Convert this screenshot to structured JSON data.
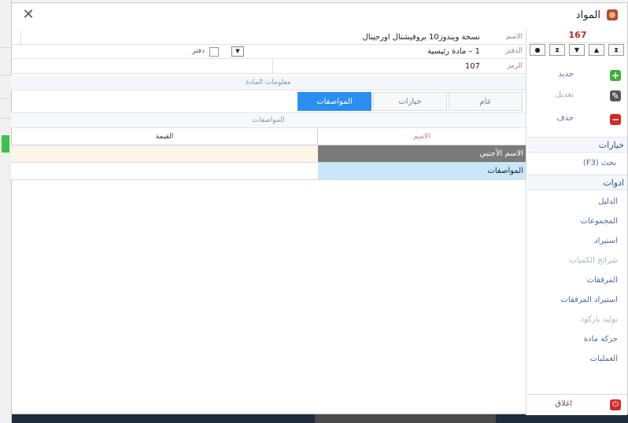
{
  "window": {
    "title": "المواد"
  },
  "sidebar": {
    "record_number": "167",
    "nav_buttons": [
      "●",
      "⧗",
      "▼",
      "▲",
      "⧗"
    ],
    "actions": [
      {
        "label": "جديد",
        "icon": "plus-icon",
        "color": "#3fae3f"
      },
      {
        "label": "تعديل",
        "icon": "edit-icon",
        "color": "#555555"
      },
      {
        "label": "حذف",
        "icon": "minus-icon",
        "color": "#d12a2a"
      }
    ],
    "options_header": "خيارات",
    "search_label": "بحث (F3)",
    "tools_header": "ادوات",
    "tools": [
      {
        "label": "الدليل",
        "enabled": true
      },
      {
        "label": "المجموعات",
        "enabled": true
      },
      {
        "label": "استيراد",
        "enabled": true
      },
      {
        "label": "شرائح الكميات",
        "enabled": false
      },
      {
        "label": "المرفقات",
        "enabled": true
      },
      {
        "label": "استيراد المرفقات",
        "enabled": true
      },
      {
        "label": "توليد باركود",
        "enabled": false
      },
      {
        "label": "حركة مادة",
        "enabled": true
      },
      {
        "label": "العمليات",
        "enabled": true
      }
    ],
    "close_label": "اغلاق"
  },
  "form": {
    "name_label": "الاسم",
    "name_value": "نسخة ويندوز10 بروفيشنال اورجينال",
    "book_label": "الدفتر",
    "book_value": "1 – مادة رئيسية",
    "book_checkbox_label": "دفتر",
    "code_label": "الرمز",
    "code_value": "107",
    "info_header": "معلومات المادة",
    "tabs": [
      {
        "label": "عام",
        "active": false
      },
      {
        "label": "خيارات",
        "active": false
      },
      {
        "label": "المواصفات",
        "active": true
      }
    ],
    "specs_header": "المواصفات",
    "table": {
      "col_name": "الاسم",
      "col_value": "القيمة",
      "rows": [
        {
          "name": "الاسم الأجنبي",
          "value": ""
        },
        {
          "name": "المواصفات",
          "value": ""
        }
      ]
    }
  }
}
